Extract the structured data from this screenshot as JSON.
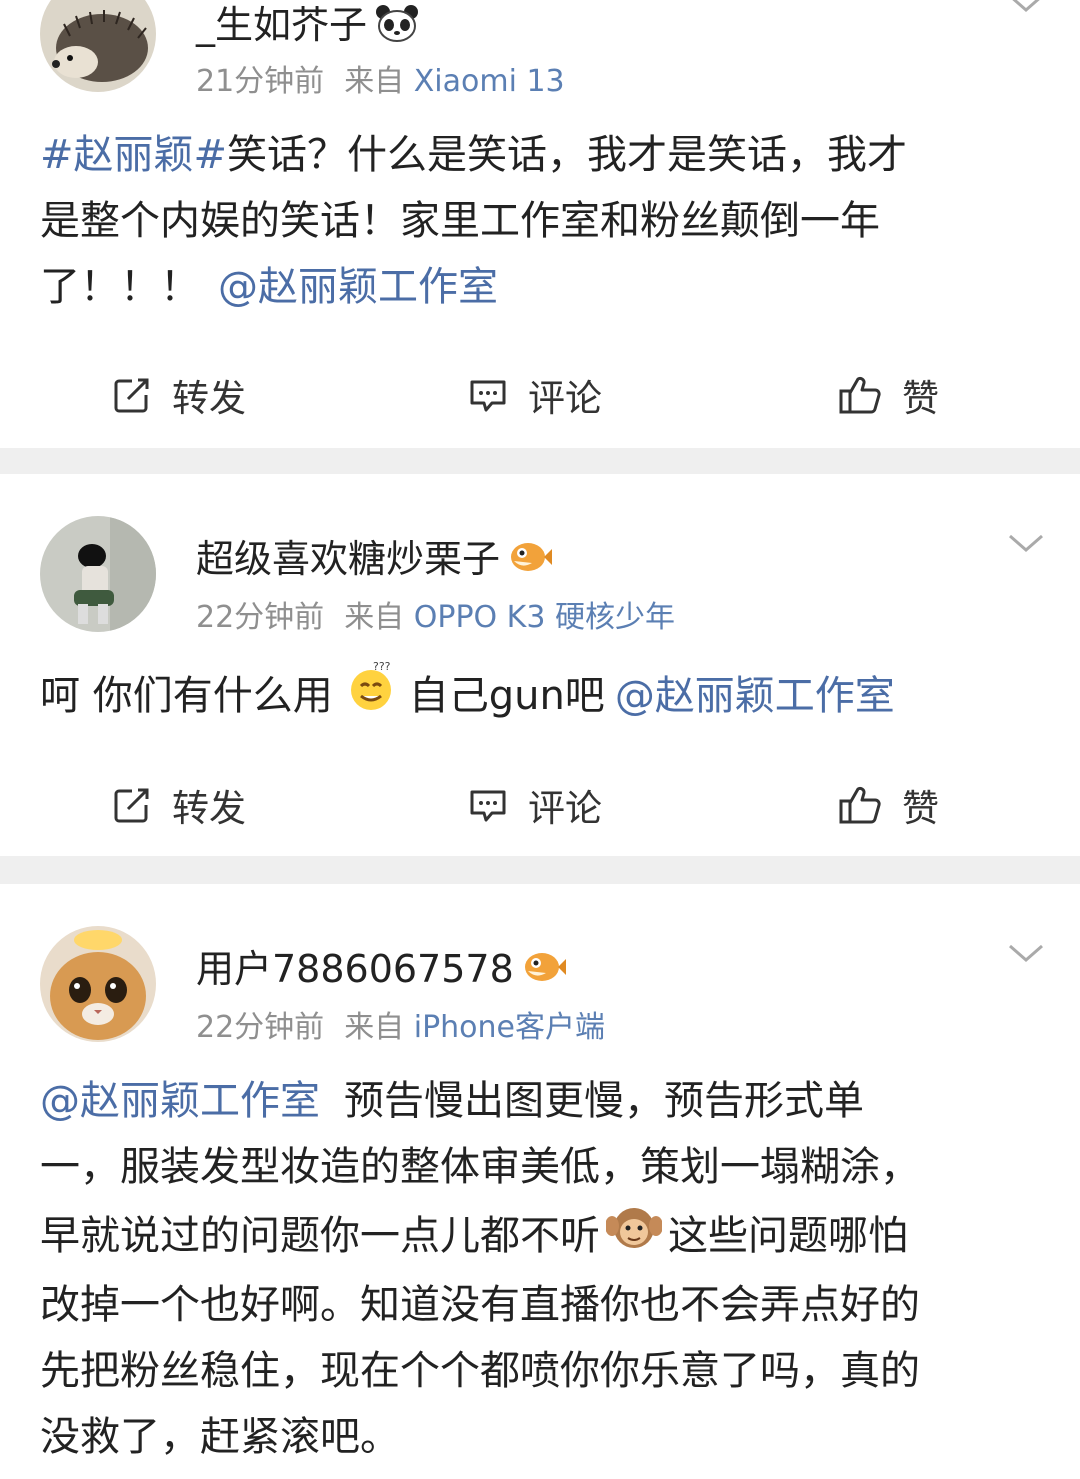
{
  "posts": [
    {
      "username": "_生如芥子",
      "badge_icon": "panda-icon",
      "time": "21分钟前",
      "from_prefix": "来自",
      "source": "Xiaomi 13",
      "text_parts": {
        "hashtag": "#赵丽颖#",
        "line1_rest": "笑话？什么是笑话，我才是笑话，我才",
        "line2": "是整个内娱的笑话！家里工作室和粉丝颠倒一年",
        "line3": "了！！！",
        "mention": "@赵丽颖工作室"
      }
    },
    {
      "username": "超级喜欢糖炒栗子",
      "badge_icon": "pufferfish-icon",
      "time": "22分钟前",
      "from_prefix": "来自",
      "source": "OPPO K3 硬核少年",
      "text_parts": {
        "before_emoji": "呵 你们有什么用",
        "emoji": "dizzy-smile-emoji",
        "after_emoji": "自己gun吧",
        "mention": "@赵丽颖工作室"
      }
    },
    {
      "username": "用户7886067578",
      "badge_icon": "pufferfish-icon",
      "time": "22分钟前",
      "from_prefix": "来自",
      "source": "iPhone客户端",
      "text_parts": {
        "mention": "@赵丽颖工作室",
        "line1_rest": "预告慢出图更慢，预告形式单",
        "line2": "一，服装发型妆造的整体审美低，策划一塌糊涂，",
        "line3_before": "早就说过的问题你一点儿都不听",
        "emoji": "monkey-cover-ears-emoji",
        "line3_after": "这些问题哪怕",
        "line4": "改掉一个也好啊。知道没有直播你也不会弄点好的",
        "line5": "先把粉丝稳住，现在个个都喷你你乐意了吗，真的",
        "line6": "没救了，赶紧滚吧。"
      }
    }
  ],
  "actions": {
    "repost": "转发",
    "comment": "评论",
    "like": "赞"
  },
  "colors": {
    "link": "#4b6da6",
    "source": "#5b7fb3",
    "meta": "#8f8f8f",
    "separator": "#efefef"
  }
}
